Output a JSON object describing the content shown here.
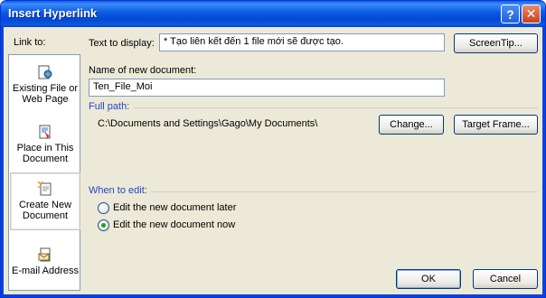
{
  "window": {
    "title": "Insert Hyperlink",
    "help_glyph": "?",
    "close_glyph": "✕"
  },
  "sidebar": {
    "label": "Link to:",
    "items": [
      {
        "label_line1": "Existing File or",
        "label_line2": "Web Page",
        "icon": "existing-file-icon"
      },
      {
        "label_line1": "Place in This",
        "label_line2": "Document",
        "icon": "place-in-document-icon"
      },
      {
        "label_line1": "Create New",
        "label_line2": "Document",
        "icon": "create-new-document-icon"
      },
      {
        "label_line1": "E-mail Address",
        "label_line2": "",
        "icon": "email-address-icon"
      }
    ],
    "selected_index": 2
  },
  "text_to_display": {
    "label": "Text to display:",
    "value": "* Tạo liên kết đến 1 file mới sẽ được tạo."
  },
  "screentip_button": "ScreenTip...",
  "new_document": {
    "label": "Name of new document:",
    "value": "Ten_File_Moi"
  },
  "full_path": {
    "label": "Full path:",
    "value": "C:\\Documents and Settings\\Gago\\My Documents\\"
  },
  "change_button": "Change...",
  "target_frame_button": "Target Frame...",
  "when_to_edit": {
    "label": "When to edit:",
    "options": [
      {
        "label": "Edit the new document later",
        "checked": false
      },
      {
        "label": "Edit the new document now",
        "checked": true
      }
    ]
  },
  "ok_button": "OK",
  "cancel_button": "Cancel"
}
